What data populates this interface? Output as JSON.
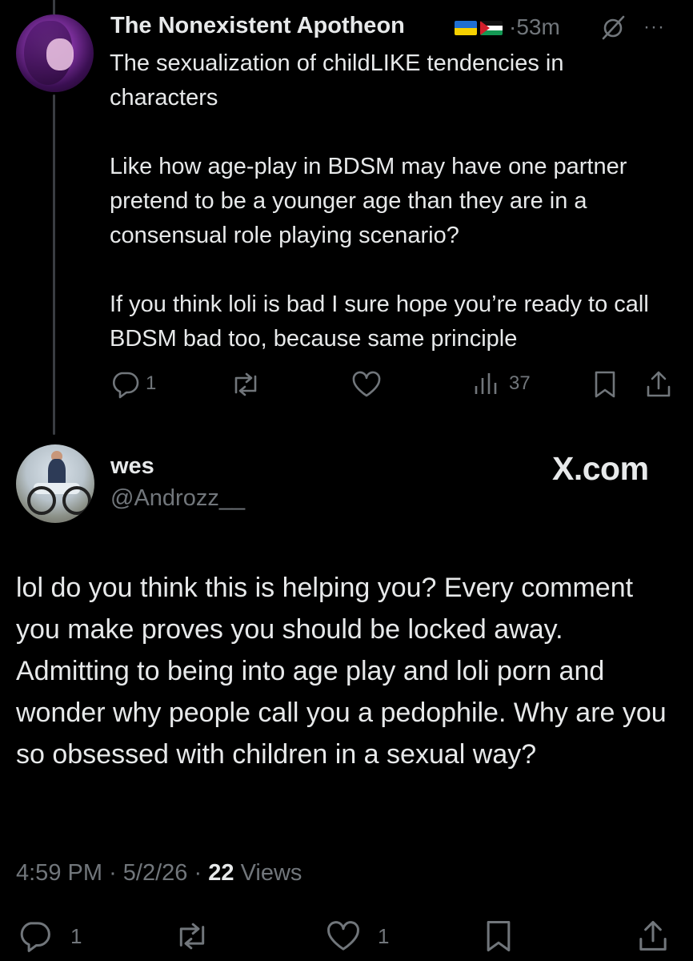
{
  "reply_to": {
    "author_name": "The Nonexistent Apotheon",
    "flags": [
      "ukraine-flag",
      "palestine-flag"
    ],
    "separator": "·",
    "time": "53m",
    "more": "···",
    "text": [
      "The sexualization of childLIKE tendencies in characters",
      "",
      "Like how age-play in BDSM may have one partner pretend to be a younger age than they are in a consensual role playing scenario?",
      "",
      "If you think loli is bad I sure hope you’re ready to call BDSM bad too, because same principle"
    ],
    "replies": "1",
    "reposts": "",
    "likes": "",
    "views": "37"
  },
  "main_post": {
    "author_name": "wes",
    "handle": "@Androzz__",
    "watermark": "X.com",
    "text": "lol do you think this is helping you? Every comment you make proves you should be locked away. Admitting to being into age play and loli porn and wonder why people call you a pedophile. Why are you so obsessed with children in a sexual way?",
    "time": "4:59 PM",
    "sep": "·",
    "date": "5/2/26",
    "views_count": "22",
    "views_label": "Views",
    "replies": "1",
    "reposts": "",
    "likes": "1"
  },
  "colors": {
    "background": "#000000",
    "text": "#e7e9ea",
    "muted": "#71767b",
    "thread_line": "#3a3d42"
  }
}
